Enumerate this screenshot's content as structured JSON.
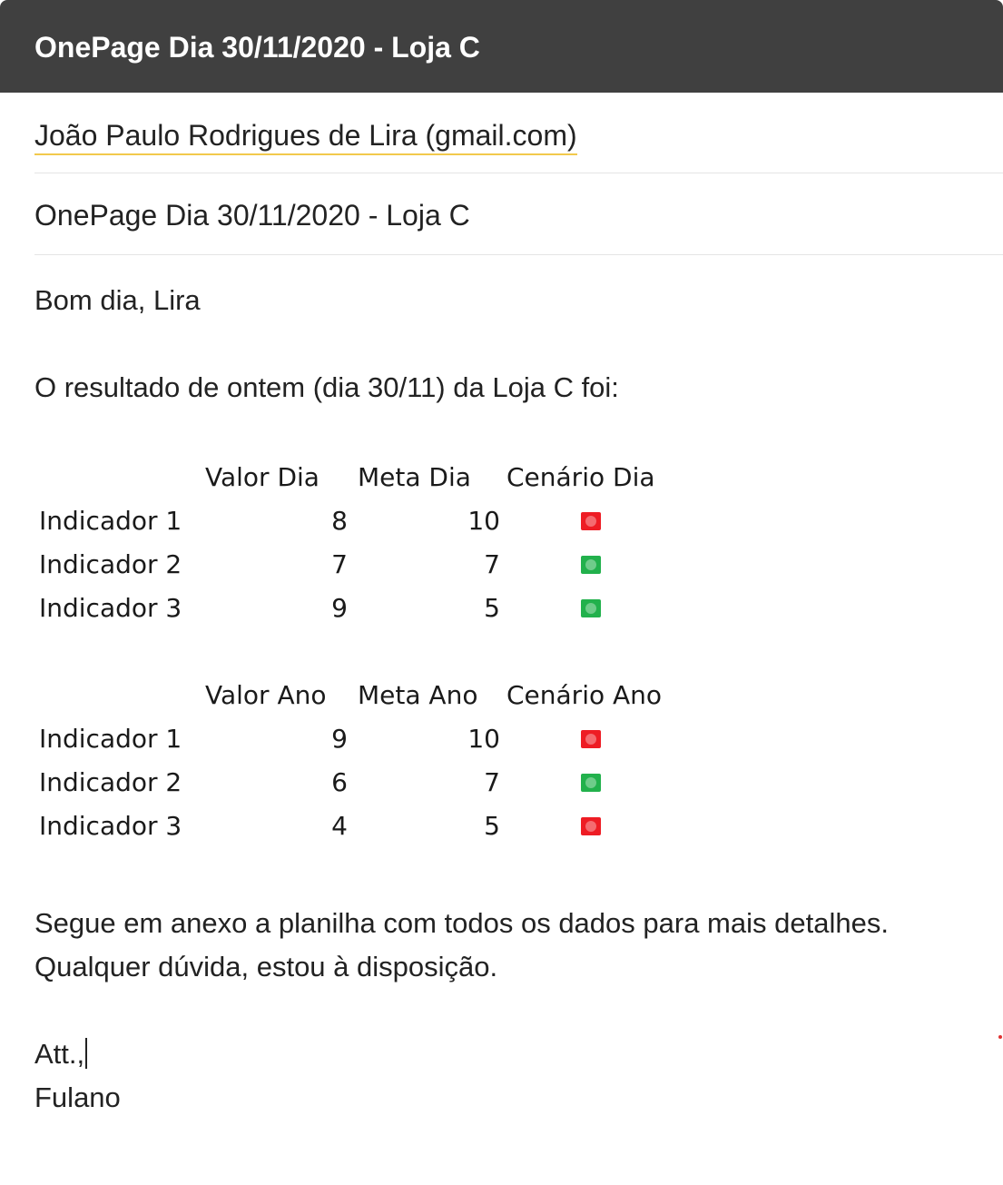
{
  "window": {
    "title": "OnePage Dia 30/11/2020 - Loja C"
  },
  "recipient": {
    "label": "João Paulo Rodrigues de Lira (gmail.com)"
  },
  "subject": {
    "value": "OnePage Dia 30/11/2020 - Loja C"
  },
  "body": {
    "greeting": "Bom dia, Lira",
    "intro": "O resultado de ontem (dia 30/11) da Loja C foi:",
    "closing_line1": "Segue em anexo a planilha com todos os dados para mais detalhes.",
    "closing_line2": "Qualquer dúvida, estou à disposição.",
    "signoff": "Att.,",
    "signature": "Fulano"
  },
  "colors": {
    "status_red": "#ee1c24",
    "status_green": "#22b14c",
    "header_bg": "#404040",
    "recipient_underline": "#f2c94c"
  },
  "table_day": {
    "headers": [
      "Valor Dia",
      "Meta Dia",
      "Cenário Dia"
    ],
    "rows": [
      {
        "label": "Indicador 1",
        "valor": "8",
        "meta": "10",
        "status": "red"
      },
      {
        "label": "Indicador 2",
        "valor": "7",
        "meta": "7",
        "status": "green"
      },
      {
        "label": "Indicador 3",
        "valor": "9",
        "meta": "5",
        "status": "green"
      }
    ]
  },
  "table_year": {
    "headers": [
      "Valor Ano",
      "Meta Ano",
      "Cenário Ano"
    ],
    "rows": [
      {
        "label": "Indicador 1",
        "valor": "9",
        "meta": "10",
        "status": "red"
      },
      {
        "label": "Indicador 2",
        "valor": "6",
        "meta": "7",
        "status": "green"
      },
      {
        "label": "Indicador 3",
        "valor": "4",
        "meta": "5",
        "status": "red"
      }
    ]
  }
}
